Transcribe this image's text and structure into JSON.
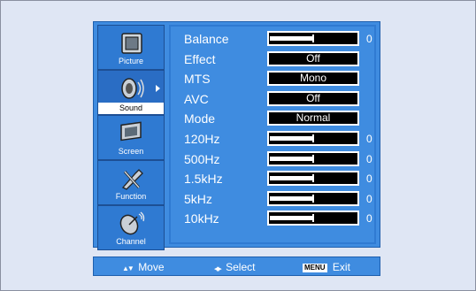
{
  "tabs": [
    {
      "label": "Picture",
      "icon": "picture-icon",
      "active": false
    },
    {
      "label": "Sound",
      "icon": "sound-icon",
      "active": true
    },
    {
      "label": "Screen",
      "icon": "screen-icon",
      "active": false
    },
    {
      "label": "Function",
      "icon": "function-icon",
      "active": false
    },
    {
      "label": "Channel",
      "icon": "channel-icon",
      "active": false
    }
  ],
  "rows": [
    {
      "name": "Balance",
      "type": "slider",
      "level": 0.5,
      "value": "0"
    },
    {
      "name": "Effect",
      "type": "option",
      "value": "Off"
    },
    {
      "name": "MTS",
      "type": "option",
      "value": "Mono"
    },
    {
      "name": "AVC",
      "type": "option",
      "value": "Off"
    },
    {
      "name": "Mode",
      "type": "option",
      "value": "Normal"
    },
    {
      "name": "120Hz",
      "type": "slider",
      "level": 0.5,
      "value": "0"
    },
    {
      "name": "500Hz",
      "type": "slider",
      "level": 0.5,
      "value": "0"
    },
    {
      "name": "1.5kHz",
      "type": "slider",
      "level": 0.5,
      "value": "0"
    },
    {
      "name": "5kHz",
      "type": "slider",
      "level": 0.5,
      "value": "0"
    },
    {
      "name": "10kHz",
      "type": "slider",
      "level": 0.5,
      "value": "0"
    }
  ],
  "footer": {
    "move": "Move",
    "move_glyph": "▲▼",
    "select": "Select",
    "select_glyph": "◀▶",
    "menu_badge": "MENU",
    "exit": "Exit"
  },
  "colors": {
    "background": "#dfe6f4",
    "panel": "#3f8ce0",
    "border": "#1e5fae"
  }
}
